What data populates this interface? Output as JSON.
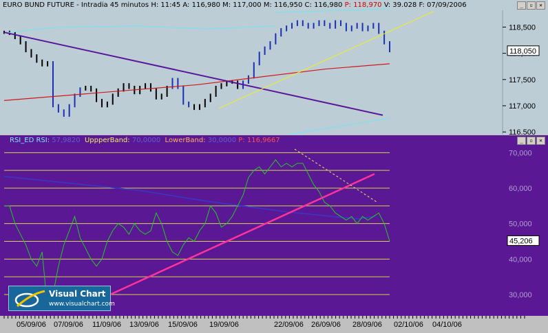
{
  "price_window": {
    "title_main": "EURO BUND FUTURE - Intradia 45 minutos H: 11:45  A: 116,980  M: 117,000  M: 116,950  C: 116,980",
    "title_red": "P: 118,970",
    "title_tail": "V: 39.028  F: 07/09/2006",
    "buttons": [
      "_",
      "▫",
      "✕"
    ],
    "price_box": "118,050",
    "colors": {
      "background": "#bccdd5",
      "price": "#000000",
      "upper_band": "#7fe0ee",
      "ma": "#d01818",
      "trend_down": "#5a169a",
      "trend_up": "#f0f020"
    }
  },
  "rsi_window": {
    "label_rsi": "RSI_ED  RSI:",
    "label_rsi_val": "57,9820",
    "label_upper": "UppperBand:",
    "label_upper_val": "70,0000",
    "label_lower": "LowerBand:",
    "label_lower_val": "30,0000",
    "label_p": "P: 116,9667",
    "buttons": [
      "_",
      "▫",
      "✕"
    ],
    "value_box": "45,206",
    "colors": {
      "background": "#5a1894",
      "rsi": "#22cc22",
      "levels": "#d6d650",
      "trend_up": "#ff3399",
      "trend_down": "#e8e860",
      "band": "#3838c8"
    }
  },
  "logo": {
    "name": "Visual Chart",
    "url": "www.visualchart.com"
  },
  "chart_data": [
    {
      "type": "line",
      "title": "EURO BUND FUTURE - Intradia 45 minutos",
      "y_ticks": [
        "118,500",
        "118,000",
        "117,500",
        "117,000",
        "116,500"
      ],
      "ylim": [
        116.45,
        118.82
      ],
      "x_dates": [
        "05/09/06",
        "07/09/06",
        "11/09/06",
        "13/09/06",
        "15/09/06",
        "19/09/06",
        "22/09/06",
        "26/09/06",
        "28/09/06",
        "02/10/06",
        "04/10/06"
      ],
      "series": [
        {
          "values": [
            118.4,
            118.38,
            118.3,
            118.2,
            118.05,
            117.95,
            117.85,
            117.78,
            117.82,
            117.0,
            116.9,
            116.82,
            117.0,
            117.2,
            117.32,
            117.35,
            117.3,
            117.1,
            117.0,
            117.05,
            117.2,
            117.3,
            117.4,
            117.35,
            117.25,
            117.35,
            117.4,
            117.3,
            117.15,
            117.2,
            117.35,
            117.5,
            117.35,
            117.05,
            117.0,
            116.95,
            117.0,
            117.1,
            117.2,
            117.35,
            117.4,
            117.45,
            117.45,
            117.35,
            117.45,
            117.55,
            117.8,
            118.0,
            118.1,
            118.2,
            118.35,
            118.45,
            118.5,
            118.55,
            118.6,
            118.55,
            118.5,
            118.55,
            118.6,
            118.55,
            118.5,
            118.6,
            118.55,
            118.45,
            118.5,
            118.55,
            118.45,
            118.5,
            118.55,
            118.4,
            118.2,
            118.05
          ]
        },
        {
          "values": [
            118.78,
            118.8,
            118.82,
            118.85
          ]
        },
        {
          "values": [
            117.1,
            117.2,
            117.3,
            117.4,
            117.55,
            117.7,
            117.8
          ]
        }
      ]
    },
    {
      "type": "line",
      "title": "RSI_ED",
      "y_ticks": [
        "70,000",
        "60,000",
        "50,000",
        "40,000",
        "30,000"
      ],
      "ylim": [
        24,
        72
      ],
      "levels": [
        70,
        65,
        60,
        55,
        50,
        45,
        40,
        35,
        30
      ],
      "series": [
        {
          "values": [
            55,
            55,
            50,
            47,
            44,
            40,
            38,
            42,
            26,
            30,
            38,
            44,
            48,
            52,
            46,
            43,
            40,
            38,
            40,
            45,
            48,
            50,
            49,
            47,
            50,
            48,
            47,
            48,
            53,
            50,
            45,
            42,
            41,
            44,
            46,
            45,
            48,
            50,
            55,
            53,
            49,
            50,
            52,
            55,
            58,
            63,
            65,
            66,
            64,
            66,
            68,
            66,
            67,
            66,
            67,
            67,
            64,
            61,
            59,
            56,
            55,
            53,
            52,
            51,
            52,
            50,
            52,
            51,
            52,
            53,
            50,
            45
          ]
        }
      ]
    }
  ]
}
